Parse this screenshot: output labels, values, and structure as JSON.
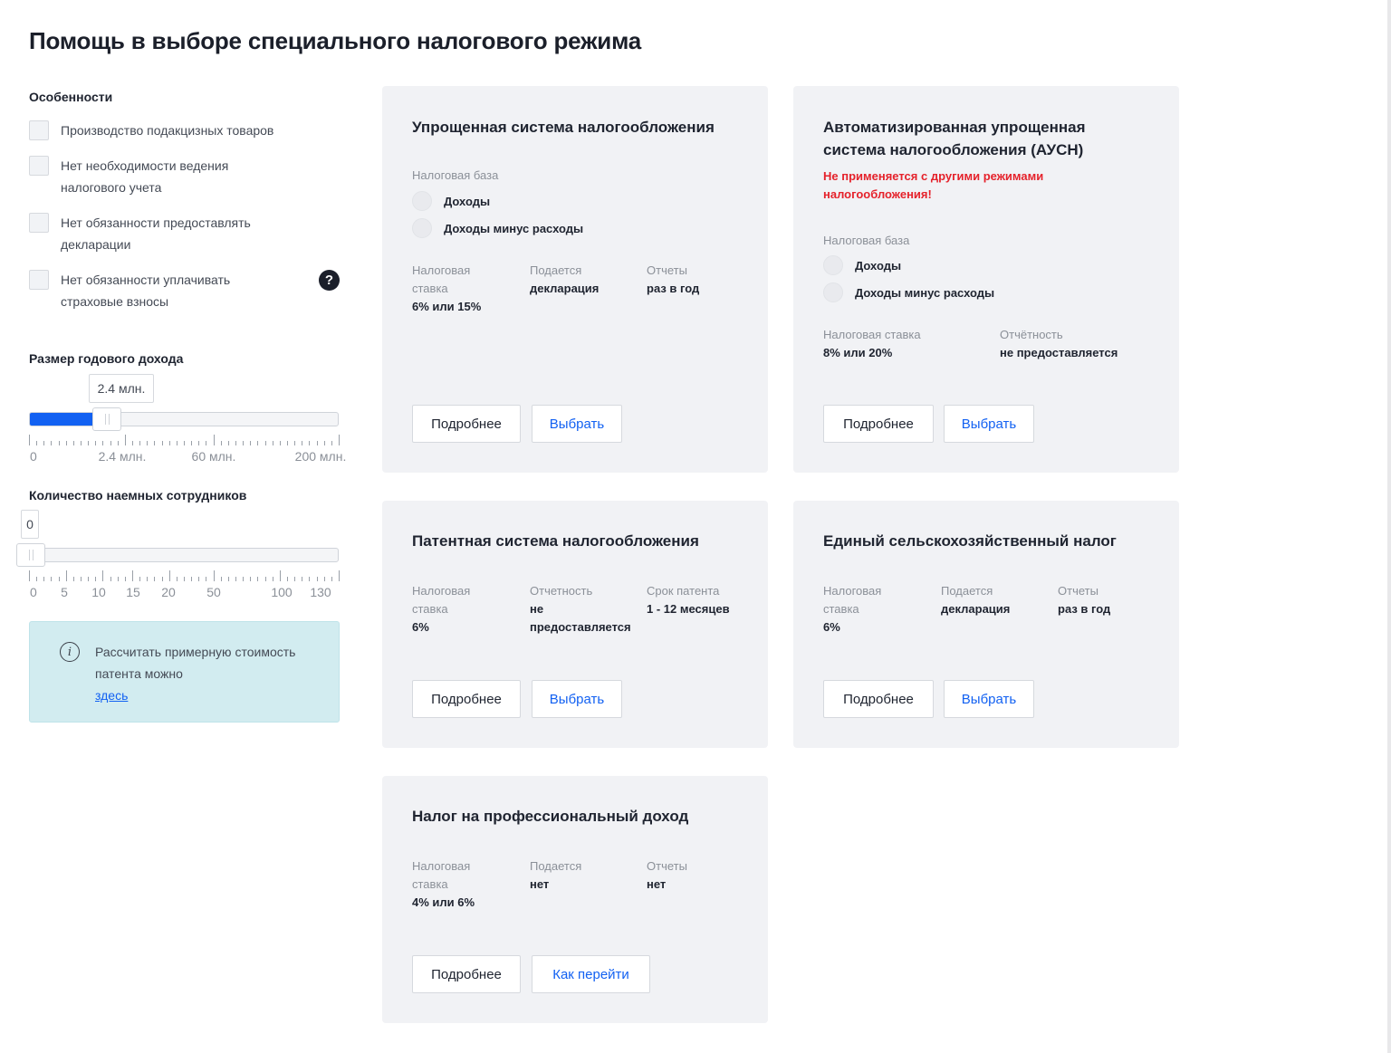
{
  "page": {
    "title": "Помощь в выборе специального налогового режима"
  },
  "features": {
    "label": "Особенности",
    "items": [
      {
        "text": "Производство подакцизных товаров"
      },
      {
        "text": "Нет необходимости ведения налогового учета"
      },
      {
        "text": "Нет обязанности предоставлять декларации"
      },
      {
        "text": "Нет обязанности уплачивать страховые взносы"
      }
    ],
    "help_symbol": "?"
  },
  "income": {
    "label": "Размер годового дохода",
    "value_text": "2.4 млн.",
    "fill_fraction": 0.25,
    "tick_labels": [
      "0",
      "2.4 млн.",
      "60 млн.",
      "200 млн."
    ]
  },
  "employees": {
    "label": "Количество наемных сотрудников",
    "value_text": "0",
    "fill_fraction": 0,
    "tick_labels": [
      "0",
      "5",
      "10",
      "15",
      "20",
      "50",
      "100",
      "130"
    ]
  },
  "info": {
    "icon_symbol": "i",
    "text": "Рассчитать примерную стоимость патента можно",
    "link": "здесь"
  },
  "cards": {
    "usn": {
      "title": "Упрощенная система налогообложения",
      "base_label": "Налоговая база",
      "options": [
        "Доходы",
        "Доходы минус расходы"
      ],
      "cols": [
        {
          "label": "Налоговая ставка",
          "value": "6% или 15%"
        },
        {
          "label": "Подается",
          "value": "декларация"
        },
        {
          "label": "Отчеты",
          "value": "раз в год"
        }
      ],
      "more": "Подробнее",
      "action": "Выбрать"
    },
    "ausn": {
      "title": "Автоматизированная упрощенная система налогообложения (АУСН)",
      "warning": "Не применяется с другими режимами налогообложения!",
      "base_label": "Налоговая база",
      "options": [
        "Доходы",
        "Доходы минус расходы"
      ],
      "cols": [
        {
          "label": "Налоговая ставка",
          "value": "8% или 20%"
        },
        {
          "label": "Отчётность",
          "value": "не предоставляется"
        }
      ],
      "more": "Подробнее",
      "action": "Выбрать"
    },
    "psn": {
      "title": "Патентная система налогообложения",
      "cols": [
        {
          "label": "Налоговая ставка",
          "value": "6%"
        },
        {
          "label": "Отчетность",
          "value": "не предоставляется"
        },
        {
          "label": "Срок патента",
          "value": "1 - 12 месяцев"
        }
      ],
      "more": "Подробнее",
      "action": "Выбрать"
    },
    "eshn": {
      "title": "Единый сельскохозяйственный налог",
      "cols": [
        {
          "label": "Налоговая ставка",
          "value": "6%"
        },
        {
          "label": "Подается",
          "value": "декларация"
        },
        {
          "label": "Отчеты",
          "value": "раз в год"
        }
      ],
      "more": "Подробнее",
      "action": "Выбрать"
    },
    "npd": {
      "title": "Налог на профессиональный доход",
      "cols": [
        {
          "label": "Налоговая ставка",
          "value": "4% или 6%"
        },
        {
          "label": "Подается",
          "value": "нет"
        },
        {
          "label": "Отчеты",
          "value": "нет"
        }
      ],
      "more": "Подробнее",
      "action": "Как перейти"
    }
  },
  "colors": {
    "accent": "#1261f2",
    "warning": "#e5222b",
    "card_bg": "#f1f2f5",
    "info_bg": "#d2ecf0"
  }
}
